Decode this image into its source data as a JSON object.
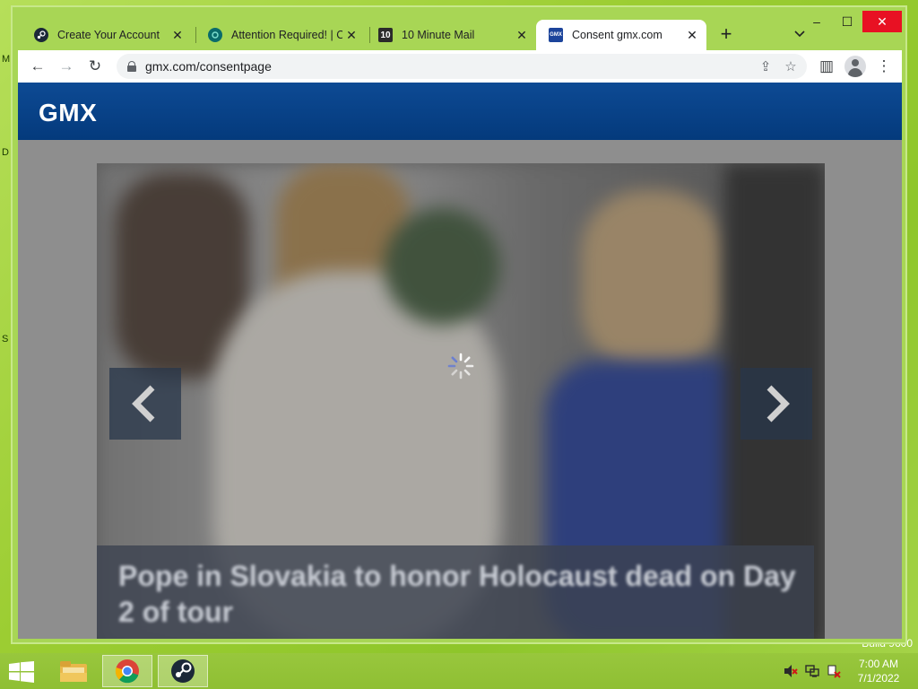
{
  "desktop": {
    "left_letters": [
      "M",
      "D",
      "S"
    ],
    "build_text": "Build 9600"
  },
  "window": {
    "controls": {
      "minimize": "–",
      "maximize": "☐",
      "close": "✕"
    },
    "tabs": [
      {
        "title": "Create Your Account",
        "icon": "steam-icon",
        "active": false
      },
      {
        "title": "Attention Required! | Cl",
        "icon": "cloudflare-icon",
        "active": false
      },
      {
        "title": "10 Minute Mail",
        "icon": "ten-minute-mail-icon",
        "active": false
      },
      {
        "title": "Consent gmx.com",
        "icon": "gmx-icon",
        "active": true
      }
    ],
    "fav_text": {
      "tenmin": "10",
      "gmx": "GMX"
    },
    "new_tab_label": "+",
    "tab_search_label": "⌄",
    "close_tab_label": "✕"
  },
  "toolbar": {
    "url": "gmx.com/consentpage",
    "back": "←",
    "forward": "→",
    "reload": "↻",
    "share": "⇪",
    "bookmark": "☆",
    "sidebar": "▥",
    "menu": "⋮"
  },
  "page": {
    "logo": "GMX",
    "caption": "Pope in Slovakia to honor Holocaust dead on Day 2 of tour",
    "colors": {
      "header": "#043a7c",
      "overlay": "#8e8e8e"
    }
  },
  "taskbar": {
    "time": "7:00 AM",
    "date": "7/1/2022"
  }
}
